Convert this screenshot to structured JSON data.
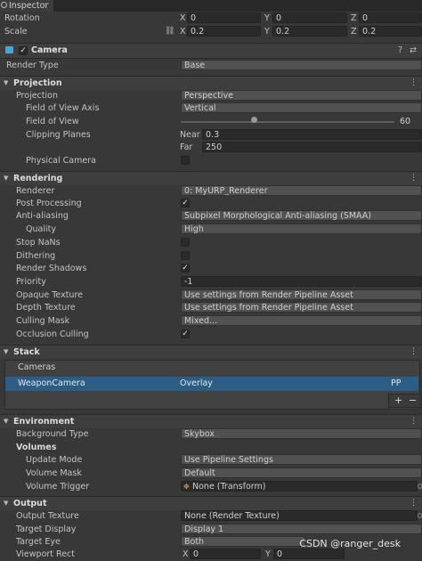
{
  "tab": {
    "title": "Inspector"
  },
  "transform": {
    "rotation_label": "Rotation",
    "scale_label": "Scale",
    "x": "X",
    "y": "Y",
    "z": "Z",
    "rotation": [
      "0",
      "0",
      "0"
    ],
    "scale": [
      "0.2",
      "0.2",
      "0.2"
    ]
  },
  "camera_header": {
    "title": "Camera",
    "help": "?",
    "settings": "⇄"
  },
  "render_type": {
    "label": "Render Type",
    "value": "Base"
  },
  "sections": {
    "projection": "Projection",
    "rendering": "Rendering",
    "stack": "Stack",
    "environment": "Environment",
    "output": "Output"
  },
  "projection": {
    "projection_label": "Projection",
    "projection_value": "Perspective",
    "fov_axis_label": "Field of View Axis",
    "fov_axis_value": "Vertical",
    "fov_label": "Field of View",
    "fov_value": "60",
    "fov_fraction": 0.34,
    "clipping_label": "Clipping Planes",
    "near_label": "Near",
    "near_value": "0.3",
    "far_label": "Far",
    "far_value": "250",
    "physical_label": "Physical Camera"
  },
  "rendering": {
    "renderer_label": "Renderer",
    "renderer_value": "0: MyURP_Renderer",
    "post_label": "Post Processing",
    "aa_label": "Anti-aliasing",
    "aa_value": "Subpixel Morphological Anti-aliasing (SMAA)",
    "quality_label": "Quality",
    "quality_value": "High",
    "stopnans_label": "Stop NaNs",
    "dithering_label": "Dithering",
    "shadows_label": "Render Shadows",
    "priority_label": "Priority",
    "priority_value": "-1",
    "opaque_label": "Opaque Texture",
    "opaque_value": "Use settings from Render Pipeline Asset",
    "depth_label": "Depth Texture",
    "depth_value": "Use settings from Render Pipeline Asset",
    "culling_label": "Culling Mask",
    "culling_value": "Mixed...",
    "occlusion_label": "Occlusion Culling"
  },
  "stack": {
    "cameras_label": "Cameras",
    "item_name": "WeaponCamera",
    "item_type": "Overlay",
    "item_tag": "PP",
    "add": "+",
    "remove": "−"
  },
  "environment": {
    "bg_label": "Background Type",
    "bg_value": "Skybox",
    "volumes_label": "Volumes",
    "update_label": "Update Mode",
    "update_value": "Use Pipeline Settings",
    "mask_label": "Volume Mask",
    "mask_value": "Default",
    "trigger_label": "Volume Trigger",
    "trigger_value": "None (Transform)"
  },
  "output": {
    "texture_label": "Output Texture",
    "texture_value": "None (Render Texture)",
    "display_label": "Target Display",
    "display_value": "Display 1",
    "eye_label": "Target Eye",
    "eye_value": "Both",
    "viewport_label": "Viewport Rect",
    "viewport_x": "0",
    "viewport_y": "0"
  },
  "watermark": "CSDN @ranger_desk",
  "colors": {
    "selection": "#2c5d87",
    "background": "#383838",
    "header": "#3e3e3e"
  }
}
